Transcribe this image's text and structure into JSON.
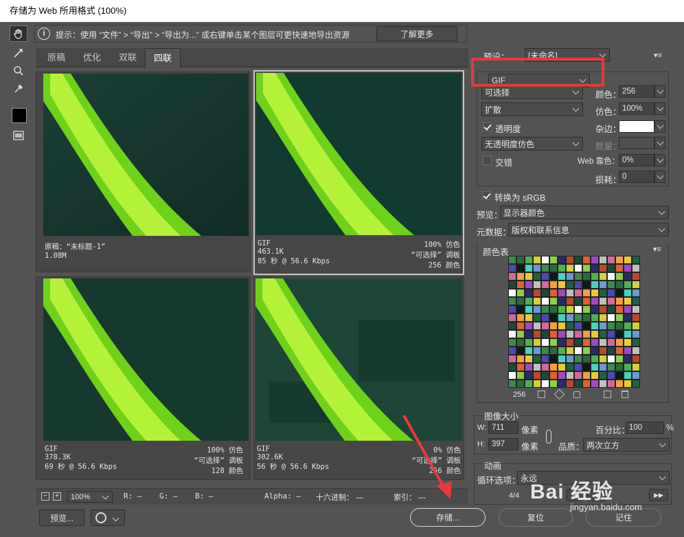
{
  "window": {
    "title": "存储为 Web 所用格式 (100%)"
  },
  "hint": {
    "text": "提示：使用 “文件” > “导出” > “导出为...” 或右键单击某个图层可更快速地导出资源",
    "learn_more": "了解更多"
  },
  "tabs": [
    "原稿",
    "优化",
    "双联",
    "四联"
  ],
  "previews": [
    {
      "l1": "原稿：“未标题-1”",
      "l2": "1.08M",
      "l3": "",
      "r1": "",
      "r2": "",
      "r3": ""
    },
    {
      "l1": "GIF",
      "l2": "463.1K",
      "l3": "85 秒 @ 56.6 Kbps",
      "r1": "100% 仿色",
      "r2": "“可选择” 调板",
      "r3": "256 颜色"
    },
    {
      "l1": "GIF",
      "l2": "378.3K",
      "l3": "69 秒 @ 56.6 Kbps",
      "r1": "100% 仿色",
      "r2": "“可选择” 调板",
      "r3": "128 颜色"
    },
    {
      "l1": "GIF",
      "l2": "302.6K",
      "l3": "56 秒 @ 56.6 Kbps",
      "r1": "0% 仿色",
      "r2": "“可选择” 调板",
      "r3": "256 颜色"
    }
  ],
  "settings": {
    "preset_label": "预设：",
    "preset_value": "[未命名]",
    "format": "GIF",
    "reduction": "可选择",
    "colors_label": "颜色：",
    "colors_value": "256",
    "dither_algo": "扩散",
    "dither_label": "仿色：",
    "dither_value": "100%",
    "transparency_label": "透明度",
    "matte_label": "杂边：",
    "trans_dither": "无透明度仿色",
    "amount_label": "数量：",
    "interlaced_label": "交错",
    "web_snap_label": "Web 靠色：",
    "web_snap_value": "0%",
    "lossy_label": "损耗：",
    "lossy_value": "0",
    "srgb_label": "转换为 sRGB",
    "preview_label": "预览：",
    "preview_value": "显示器颜色",
    "metadata_label": "元数据：",
    "metadata_value": "版权和联系信息"
  },
  "color_table": {
    "title": "颜色表",
    "count": "256"
  },
  "image_size": {
    "title": "图像大小",
    "w_label": "W:",
    "w_value": "711",
    "w_unit": "像素",
    "h_label": "H:",
    "h_value": "397",
    "h_unit": "像素",
    "percent_label": "百分比：",
    "percent_value": "100",
    "percent_unit": "%",
    "quality_label": "品质：",
    "quality_value": "两次立方"
  },
  "animation": {
    "title": "动画",
    "loop_label": "循环选项：",
    "loop_value": "永远",
    "frame": "4/4"
  },
  "status": {
    "zoom": "100%",
    "r": "R: —",
    "g": "G: —",
    "b": "B: —",
    "alpha": "Alpha: —",
    "hex": "十六进制： —",
    "index": "索引： —"
  },
  "buttons": {
    "preview": "预览...",
    "save": "存储...",
    "reset": "复位",
    "remember": "记住"
  },
  "watermark": {
    "text": "Bai 经验",
    "sub": "jingyan.baidu.com"
  },
  "colors": {
    "highlight_red": "#e83a3a"
  }
}
